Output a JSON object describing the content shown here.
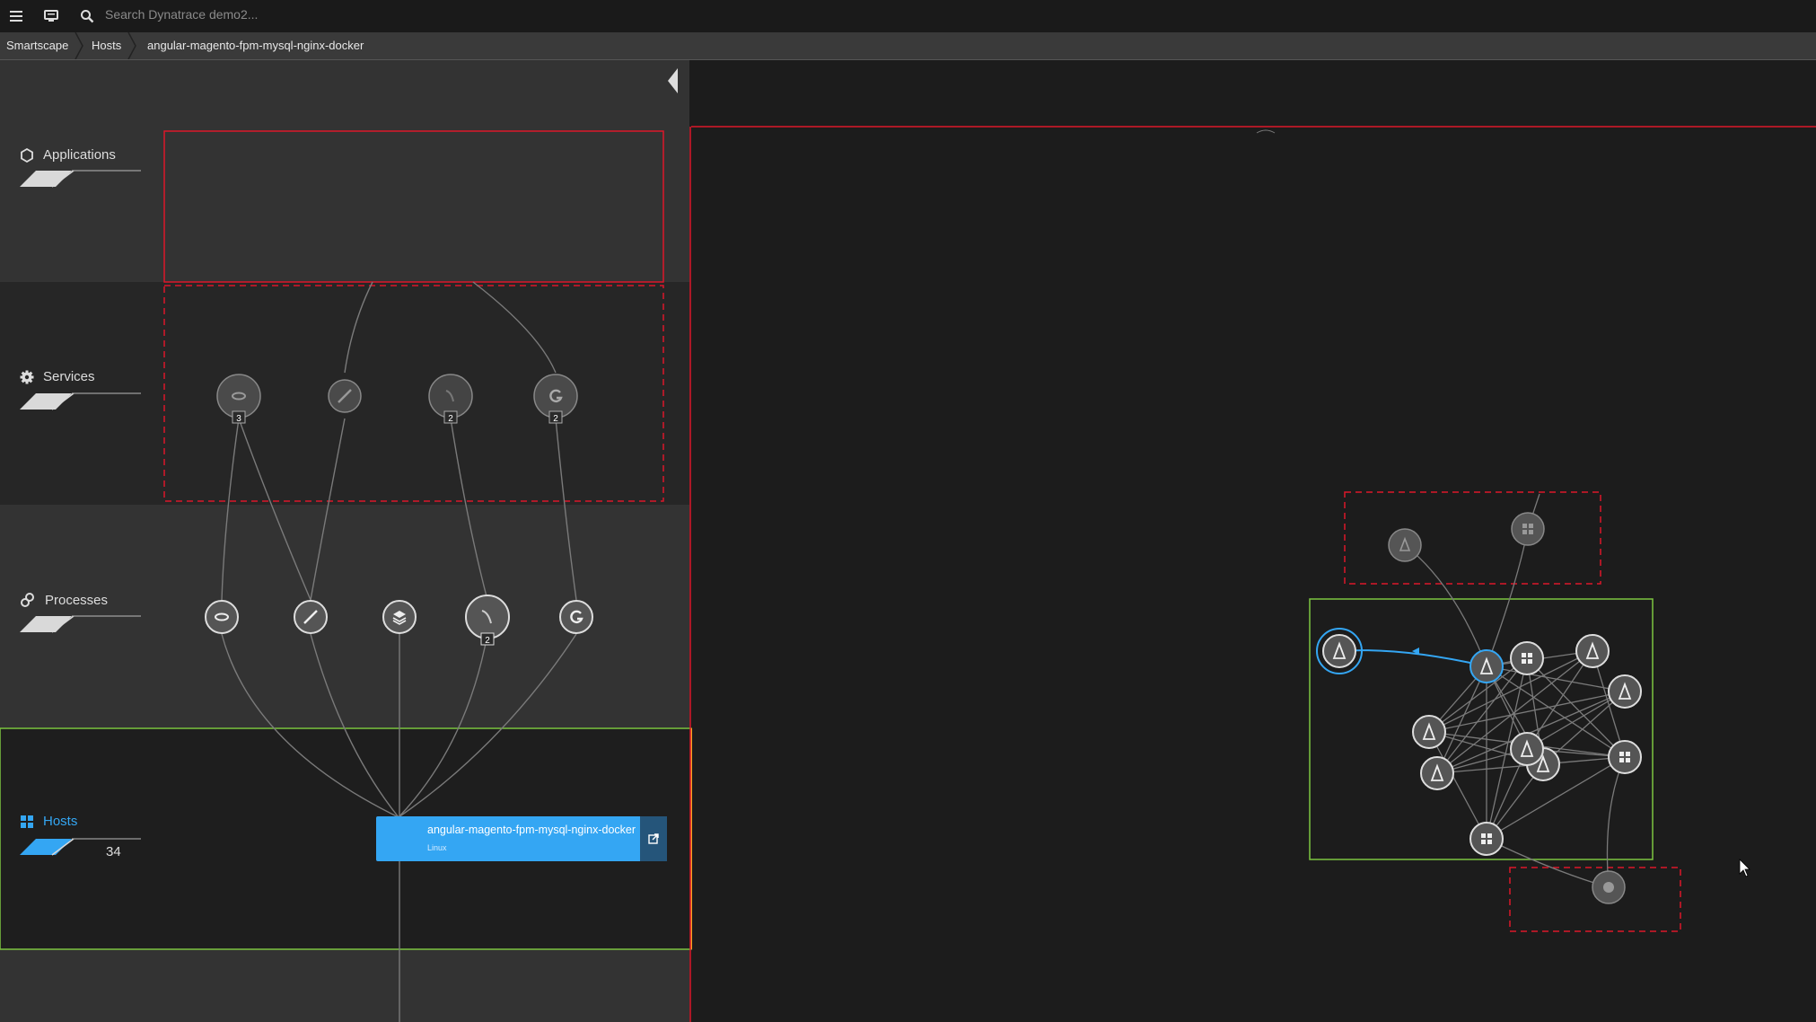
{
  "topbar": {
    "menu_icon": "hamburger-menu-icon",
    "monitor_icon": "monitor-icon",
    "search_icon": "search-icon",
    "search_placeholder": "Search Dynatrace demo2..."
  },
  "breadcrumb": [
    "Smartscape",
    "Hosts",
    "angular-magento-fpm-mysql-nginx-docker"
  ],
  "layers": {
    "applications": {
      "label": "Applications",
      "icon": "hexagon-icon"
    },
    "services": {
      "label": "Services",
      "icon": "gear-icon"
    },
    "processes": {
      "label": "Processes",
      "icon": "gears-icon"
    },
    "hosts": {
      "label": "Hosts",
      "icon": "host-icon",
      "count": "34"
    }
  },
  "services": [
    {
      "icon": "nginx-icon",
      "badge": "3"
    },
    {
      "icon": "feather-icon",
      "badge": ""
    },
    {
      "icon": "mysql-icon",
      "badge": "2"
    },
    {
      "icon": "g-icon",
      "badge": "2"
    }
  ],
  "processes": [
    {
      "icon": "nginx-icon",
      "badge": ""
    },
    {
      "icon": "feather-icon",
      "badge": ""
    },
    {
      "icon": "stack-icon",
      "badge": ""
    },
    {
      "icon": "mysql-icon",
      "badge": "2"
    },
    {
      "icon": "g-icon",
      "badge": ""
    }
  ],
  "selected_host": {
    "name": "angular-magento-fpm-mysql-nginx-docker",
    "os": "Linux",
    "icon": "linux-icon",
    "open_icon": "external-link-icon"
  },
  "colors": {
    "accent": "#34a6f3",
    "problem": "#dc172a",
    "focus": "#7dc540",
    "highlight": "#f5a623"
  }
}
